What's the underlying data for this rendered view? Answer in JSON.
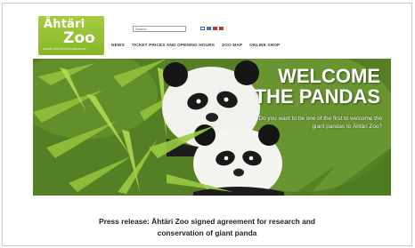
{
  "logo": {
    "word": "Ähtäri",
    "zoo": "Zoo",
    "tagline": "Nature and Animal Adventures"
  },
  "search": {
    "placeholder": "Search"
  },
  "nav": {
    "items": [
      {
        "label": "NEWS"
      },
      {
        "label": "TICKET PRICES AND OPENING HOURS"
      },
      {
        "label": "ZOO MAP"
      },
      {
        "label": "ONLINE SHOP"
      }
    ]
  },
  "hero": {
    "title_line1": "WELCOME",
    "title_line2": "THE PANDAS",
    "subtitle": "Do you want to be one of the first to welcome the giant pandas to Ähtäri Zoo?"
  },
  "press": {
    "line1": "Press release: Ähtäri Zoo signed agreement for research and",
    "line2": "conservation of giant panda"
  },
  "colors": {
    "logo_green": "#96c132",
    "nav_text": "#3a3a3a",
    "hero_foliage": "#5d8a26"
  }
}
